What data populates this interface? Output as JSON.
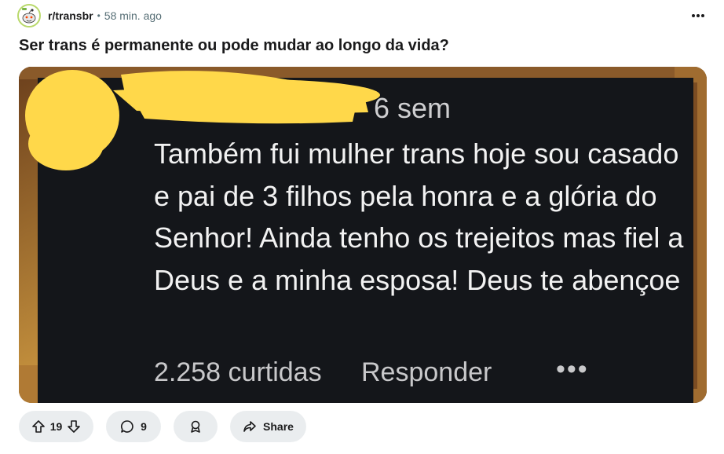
{
  "post": {
    "subreddit": "r/transbr",
    "separator": "•",
    "time": "58 min. ago",
    "title": "Ser trans é permanente ou pode mudar ao longo da vida?"
  },
  "image_card": {
    "time": "6 sem",
    "body": "Também fui mulher trans hoje sou casado e pai de 3 filhos pela honra e a glória do Senhor! Ainda tenho os trejeitos mas fiel a Deus e a minha esposa! Deus te abençoe",
    "likes": "2.258 curtidas",
    "reply": "Responder",
    "more": "•••"
  },
  "actions": {
    "upvotes": "19",
    "comments": "9",
    "share_label": "Share"
  },
  "icons": {
    "avatar": "snoo-avatar-icon",
    "more": "more-horizontal-icon",
    "upvote": "upvote-arrow-icon",
    "downvote": "downvote-arrow-icon",
    "comment": "comment-bubble-icon",
    "award": "award-icon",
    "share": "share-arrow-icon"
  },
  "colors": {
    "pill_background": "#eaedef",
    "muted_text": "#576f76",
    "redaction": "#ffd84a"
  }
}
